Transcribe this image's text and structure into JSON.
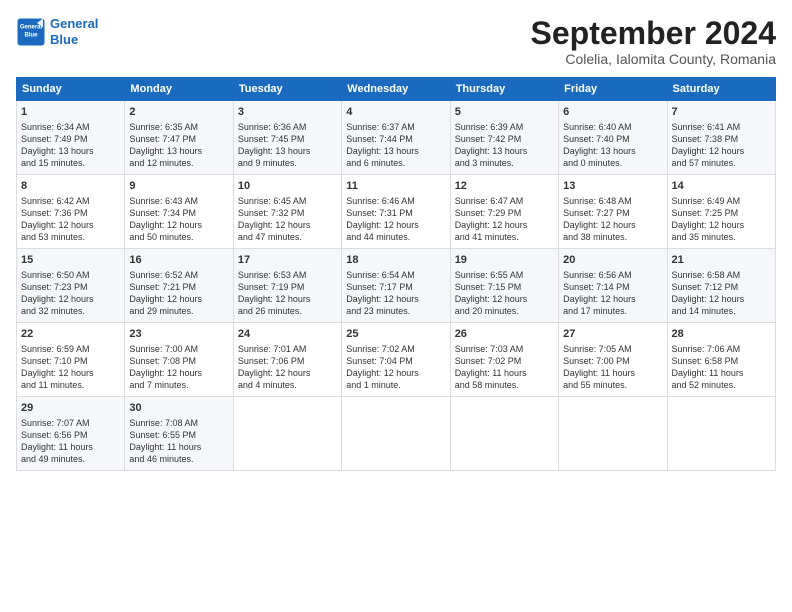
{
  "logo": {
    "line1": "General",
    "line2": "Blue"
  },
  "title": "September 2024",
  "subtitle": "Colelia, Ialomita County, Romania",
  "headers": [
    "Sunday",
    "Monday",
    "Tuesday",
    "Wednesday",
    "Thursday",
    "Friday",
    "Saturday"
  ],
  "weeks": [
    [
      {
        "day": "1",
        "lines": [
          "Sunrise: 6:34 AM",
          "Sunset: 7:49 PM",
          "Daylight: 13 hours",
          "and 15 minutes."
        ]
      },
      {
        "day": "2",
        "lines": [
          "Sunrise: 6:35 AM",
          "Sunset: 7:47 PM",
          "Daylight: 13 hours",
          "and 12 minutes."
        ]
      },
      {
        "day": "3",
        "lines": [
          "Sunrise: 6:36 AM",
          "Sunset: 7:45 PM",
          "Daylight: 13 hours",
          "and 9 minutes."
        ]
      },
      {
        "day": "4",
        "lines": [
          "Sunrise: 6:37 AM",
          "Sunset: 7:44 PM",
          "Daylight: 13 hours",
          "and 6 minutes."
        ]
      },
      {
        "day": "5",
        "lines": [
          "Sunrise: 6:39 AM",
          "Sunset: 7:42 PM",
          "Daylight: 13 hours",
          "and 3 minutes."
        ]
      },
      {
        "day": "6",
        "lines": [
          "Sunrise: 6:40 AM",
          "Sunset: 7:40 PM",
          "Daylight: 13 hours",
          "and 0 minutes."
        ]
      },
      {
        "day": "7",
        "lines": [
          "Sunrise: 6:41 AM",
          "Sunset: 7:38 PM",
          "Daylight: 12 hours",
          "and 57 minutes."
        ]
      }
    ],
    [
      {
        "day": "8",
        "lines": [
          "Sunrise: 6:42 AM",
          "Sunset: 7:36 PM",
          "Daylight: 12 hours",
          "and 53 minutes."
        ]
      },
      {
        "day": "9",
        "lines": [
          "Sunrise: 6:43 AM",
          "Sunset: 7:34 PM",
          "Daylight: 12 hours",
          "and 50 minutes."
        ]
      },
      {
        "day": "10",
        "lines": [
          "Sunrise: 6:45 AM",
          "Sunset: 7:32 PM",
          "Daylight: 12 hours",
          "and 47 minutes."
        ]
      },
      {
        "day": "11",
        "lines": [
          "Sunrise: 6:46 AM",
          "Sunset: 7:31 PM",
          "Daylight: 12 hours",
          "and 44 minutes."
        ]
      },
      {
        "day": "12",
        "lines": [
          "Sunrise: 6:47 AM",
          "Sunset: 7:29 PM",
          "Daylight: 12 hours",
          "and 41 minutes."
        ]
      },
      {
        "day": "13",
        "lines": [
          "Sunrise: 6:48 AM",
          "Sunset: 7:27 PM",
          "Daylight: 12 hours",
          "and 38 minutes."
        ]
      },
      {
        "day": "14",
        "lines": [
          "Sunrise: 6:49 AM",
          "Sunset: 7:25 PM",
          "Daylight: 12 hours",
          "and 35 minutes."
        ]
      }
    ],
    [
      {
        "day": "15",
        "lines": [
          "Sunrise: 6:50 AM",
          "Sunset: 7:23 PM",
          "Daylight: 12 hours",
          "and 32 minutes."
        ]
      },
      {
        "day": "16",
        "lines": [
          "Sunrise: 6:52 AM",
          "Sunset: 7:21 PM",
          "Daylight: 12 hours",
          "and 29 minutes."
        ]
      },
      {
        "day": "17",
        "lines": [
          "Sunrise: 6:53 AM",
          "Sunset: 7:19 PM",
          "Daylight: 12 hours",
          "and 26 minutes."
        ]
      },
      {
        "day": "18",
        "lines": [
          "Sunrise: 6:54 AM",
          "Sunset: 7:17 PM",
          "Daylight: 12 hours",
          "and 23 minutes."
        ]
      },
      {
        "day": "19",
        "lines": [
          "Sunrise: 6:55 AM",
          "Sunset: 7:15 PM",
          "Daylight: 12 hours",
          "and 20 minutes."
        ]
      },
      {
        "day": "20",
        "lines": [
          "Sunrise: 6:56 AM",
          "Sunset: 7:14 PM",
          "Daylight: 12 hours",
          "and 17 minutes."
        ]
      },
      {
        "day": "21",
        "lines": [
          "Sunrise: 6:58 AM",
          "Sunset: 7:12 PM",
          "Daylight: 12 hours",
          "and 14 minutes."
        ]
      }
    ],
    [
      {
        "day": "22",
        "lines": [
          "Sunrise: 6:59 AM",
          "Sunset: 7:10 PM",
          "Daylight: 12 hours",
          "and 11 minutes."
        ]
      },
      {
        "day": "23",
        "lines": [
          "Sunrise: 7:00 AM",
          "Sunset: 7:08 PM",
          "Daylight: 12 hours",
          "and 7 minutes."
        ]
      },
      {
        "day": "24",
        "lines": [
          "Sunrise: 7:01 AM",
          "Sunset: 7:06 PM",
          "Daylight: 12 hours",
          "and 4 minutes."
        ]
      },
      {
        "day": "25",
        "lines": [
          "Sunrise: 7:02 AM",
          "Sunset: 7:04 PM",
          "Daylight: 12 hours",
          "and 1 minute."
        ]
      },
      {
        "day": "26",
        "lines": [
          "Sunrise: 7:03 AM",
          "Sunset: 7:02 PM",
          "Daylight: 11 hours",
          "and 58 minutes."
        ]
      },
      {
        "day": "27",
        "lines": [
          "Sunrise: 7:05 AM",
          "Sunset: 7:00 PM",
          "Daylight: 11 hours",
          "and 55 minutes."
        ]
      },
      {
        "day": "28",
        "lines": [
          "Sunrise: 7:06 AM",
          "Sunset: 6:58 PM",
          "Daylight: 11 hours",
          "and 52 minutes."
        ]
      }
    ],
    [
      {
        "day": "29",
        "lines": [
          "Sunrise: 7:07 AM",
          "Sunset: 6:56 PM",
          "Daylight: 11 hours",
          "and 49 minutes."
        ]
      },
      {
        "day": "30",
        "lines": [
          "Sunrise: 7:08 AM",
          "Sunset: 6:55 PM",
          "Daylight: 11 hours",
          "and 46 minutes."
        ]
      },
      {
        "day": "",
        "lines": []
      },
      {
        "day": "",
        "lines": []
      },
      {
        "day": "",
        "lines": []
      },
      {
        "day": "",
        "lines": []
      },
      {
        "day": "",
        "lines": []
      }
    ]
  ]
}
